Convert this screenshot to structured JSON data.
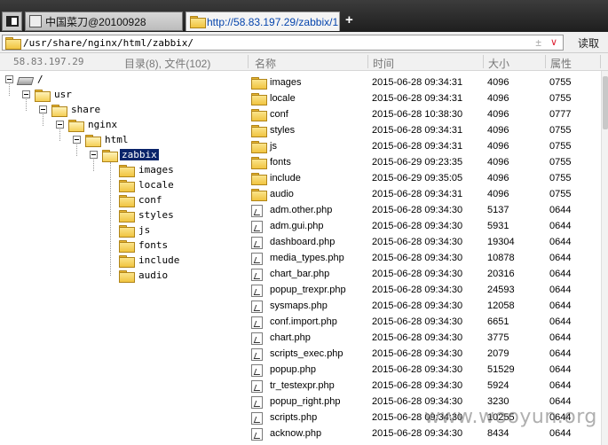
{
  "tabs": [
    {
      "label": "中国菜刀@20100928",
      "active": false
    },
    {
      "label": "http://58.83.197.29/zabbix/1...",
      "active": true
    }
  ],
  "new_tab_label": "+",
  "address": {
    "path": "/usr/share/nginx/html/zabbix/",
    "read_button": "读取"
  },
  "status": {
    "ip": "58.83.197.29",
    "summary": "目录(8), 文件(102)"
  },
  "columns": {
    "name": "名称",
    "time": "时间",
    "size": "大小",
    "perm": "属性"
  },
  "tree": {
    "root": "/",
    "nodes": [
      "usr",
      "share",
      "nginx",
      "html",
      "zabbix"
    ],
    "children": [
      "images",
      "locale",
      "conf",
      "styles",
      "js",
      "fonts",
      "include",
      "audio"
    ]
  },
  "files": [
    {
      "name": "images",
      "time": "2015-06-28 09:34:31",
      "size": "4096",
      "perm": "0755",
      "type": "dir"
    },
    {
      "name": "locale",
      "time": "2015-06-28 09:34:31",
      "size": "4096",
      "perm": "0755",
      "type": "dir"
    },
    {
      "name": "conf",
      "time": "2015-06-28 10:38:30",
      "size": "4096",
      "perm": "0777",
      "type": "dir"
    },
    {
      "name": "styles",
      "time": "2015-06-28 09:34:31",
      "size": "4096",
      "perm": "0755",
      "type": "dir"
    },
    {
      "name": "js",
      "time": "2015-06-28 09:34:31",
      "size": "4096",
      "perm": "0755",
      "type": "dir"
    },
    {
      "name": "fonts",
      "time": "2015-06-29 09:23:35",
      "size": "4096",
      "perm": "0755",
      "type": "dir"
    },
    {
      "name": "include",
      "time": "2015-06-29 09:35:05",
      "size": "4096",
      "perm": "0755",
      "type": "dir"
    },
    {
      "name": "audio",
      "time": "2015-06-28 09:34:31",
      "size": "4096",
      "perm": "0755",
      "type": "dir"
    },
    {
      "name": "adm.other.php",
      "time": "2015-06-28 09:34:30",
      "size": "5137",
      "perm": "0644",
      "type": "file"
    },
    {
      "name": "adm.gui.php",
      "time": "2015-06-28 09:34:30",
      "size": "5931",
      "perm": "0644",
      "type": "file"
    },
    {
      "name": "dashboard.php",
      "time": "2015-06-28 09:34:30",
      "size": "19304",
      "perm": "0644",
      "type": "file"
    },
    {
      "name": "media_types.php",
      "time": "2015-06-28 09:34:30",
      "size": "10878",
      "perm": "0644",
      "type": "file"
    },
    {
      "name": "chart_bar.php",
      "time": "2015-06-28 09:34:30",
      "size": "20316",
      "perm": "0644",
      "type": "file"
    },
    {
      "name": "popup_trexpr.php",
      "time": "2015-06-28 09:34:30",
      "size": "24593",
      "perm": "0644",
      "type": "file"
    },
    {
      "name": "sysmaps.php",
      "time": "2015-06-28 09:34:30",
      "size": "12058",
      "perm": "0644",
      "type": "file"
    },
    {
      "name": "conf.import.php",
      "time": "2015-06-28 09:34:30",
      "size": "6651",
      "perm": "0644",
      "type": "file"
    },
    {
      "name": "chart.php",
      "time": "2015-06-28 09:34:30",
      "size": "3775",
      "perm": "0644",
      "type": "file"
    },
    {
      "name": "scripts_exec.php",
      "time": "2015-06-28 09:34:30",
      "size": "2079",
      "perm": "0644",
      "type": "file"
    },
    {
      "name": "popup.php",
      "time": "2015-06-28 09:34:30",
      "size": "51529",
      "perm": "0644",
      "type": "file"
    },
    {
      "name": "tr_testexpr.php",
      "time": "2015-06-28 09:34:30",
      "size": "5924",
      "perm": "0644",
      "type": "file"
    },
    {
      "name": "popup_right.php",
      "time": "2015-06-28 09:34:30",
      "size": "3230",
      "perm": "0644",
      "type": "file"
    },
    {
      "name": "scripts.php",
      "time": "2015-06-28 09:34:30",
      "size": "10255",
      "perm": "0644",
      "type": "file"
    },
    {
      "name": "acknow.php",
      "time": "2015-06-28 09:34:30",
      "size": "8434",
      "perm": "0644",
      "type": "file"
    }
  ],
  "watermark": "www.wooyun.org",
  "colors": {
    "selection": "#0a246a",
    "folder": "#f1c440",
    "tab_link": "#0645ad"
  }
}
